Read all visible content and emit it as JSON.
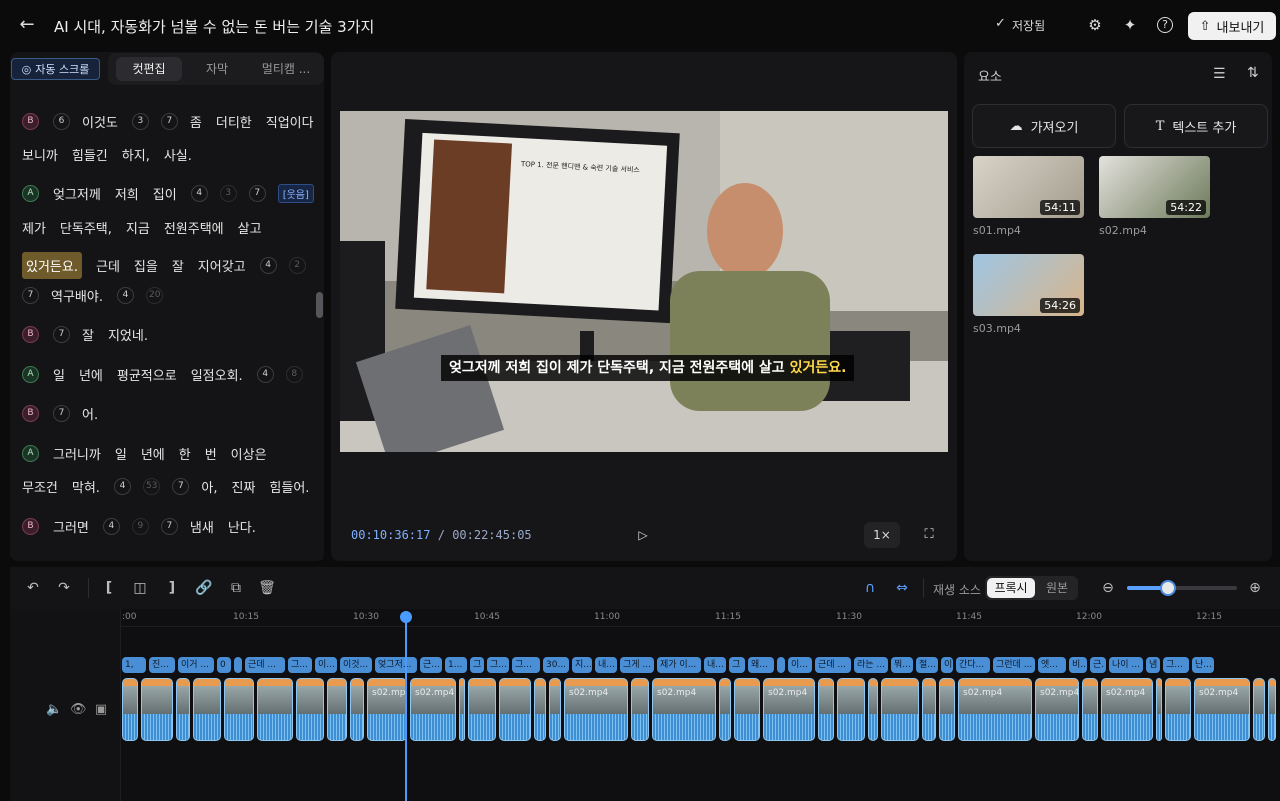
{
  "header": {
    "back_icon": "arrow-left-icon",
    "title": "AI 시대, 자동화가 넘볼 수 없는 돈 버는 기술 3가지",
    "saved_label": "저장됨",
    "export_label": "내보내기"
  },
  "left_panel": {
    "autoscroll_label": "자동 스크롤",
    "tabs": [
      "컷편집",
      "자막",
      "멀티캠 ..."
    ],
    "active_tab": "컷편집",
    "transcript": [
      {
        "speaker": "B",
        "tokens": [
          "6",
          "이것도",
          "3",
          "7",
          "좀",
          "더티한",
          "직업이다"
        ]
      },
      {
        "speaker": "",
        "tokens": [
          "보니까",
          "힘들긴",
          "하지,",
          "사실."
        ]
      },
      {
        "speaker": "A",
        "tokens": [
          "엊그저께",
          "저희",
          "집이",
          "4",
          "3",
          "7",
          "[웃음]"
        ]
      },
      {
        "speaker": "",
        "tokens": [
          "제가",
          "단독주택,",
          "지금",
          "전원주택에",
          "살고"
        ]
      },
      {
        "speaker": "",
        "tokens": [
          "있거든요.",
          "근데",
          "집을",
          "잘",
          "지어갖고",
          "4",
          "2"
        ]
      },
      {
        "speaker": "",
        "tokens": [
          "7",
          "역구배야.",
          "4",
          "20"
        ]
      },
      {
        "speaker": "B",
        "tokens": [
          "7",
          "잘",
          "지었네."
        ]
      },
      {
        "speaker": "A",
        "tokens": [
          "일",
          "년에",
          "평균적으로",
          "일점오회.",
          "4",
          "8"
        ]
      },
      {
        "speaker": "B",
        "tokens": [
          "7",
          "어."
        ]
      },
      {
        "speaker": "A",
        "tokens": [
          "그러니까",
          "일",
          "년에",
          "한",
          "번",
          "이상은"
        ]
      },
      {
        "speaker": "",
        "tokens": [
          "무조건",
          "막혀.",
          "4",
          "53",
          "7",
          "아,",
          "진짜",
          "힘들어."
        ]
      },
      {
        "speaker": "B",
        "tokens": [
          "그러면",
          "4",
          "9",
          "7",
          "냄새",
          "난다."
        ]
      }
    ]
  },
  "preview": {
    "caption_main": "엊그저께 저희 집이 제가 단독주택, 지금 전원주택에 살고 ",
    "caption_highlight": "있거든요.",
    "current_time": "00:10:36:17",
    "separator": "/",
    "total_time": "00:22:45:05",
    "speed": "1×",
    "slide_title": "TOP 1. 전문 핸디맨 & 숙련 기술 서비스"
  },
  "elements_panel": {
    "title": "요소",
    "import_label": "가져오기",
    "add_text_label": "텍스트 추가",
    "media": [
      {
        "name": "s01.mp4",
        "duration": "54:11"
      },
      {
        "name": "s02.mp4",
        "duration": "54:22"
      },
      {
        "name": "s03.mp4",
        "duration": "54:26"
      }
    ]
  },
  "timeline": {
    "source_label": "재생 소스",
    "proxy_label": "프록시",
    "original_label": "원본",
    "zoom_level": 0.35,
    "ruler_ticks": [
      ":00",
      "10:15",
      "10:30",
      "10:45",
      "11:00",
      "11:15",
      "11:30",
      "11:45",
      "12:00",
      "12:15"
    ],
    "subtitle_segments": [
      "1,",
      "진...",
      "이거 ...",
      "0",
      "",
      "근데 ...",
      "그...",
      "이...",
      "이것...",
      "엊그저...",
      "근...",
      "1...",
      "그",
      "그...",
      "그...",
      "30...",
      "지...",
      "내...",
      "그게 ...",
      "제가 이...",
      "내...",
      "그",
      "왜...",
      "",
      "이...",
      "근데 ...",
      "라는 ...",
      "뭐...",
      "절...",
      "이",
      "간다...",
      "그런데 ...",
      "엣...",
      "비...",
      "근.",
      "나이 ...",
      "냄",
      "그...",
      "난..."
    ],
    "clip_label": "s02.mp4"
  }
}
